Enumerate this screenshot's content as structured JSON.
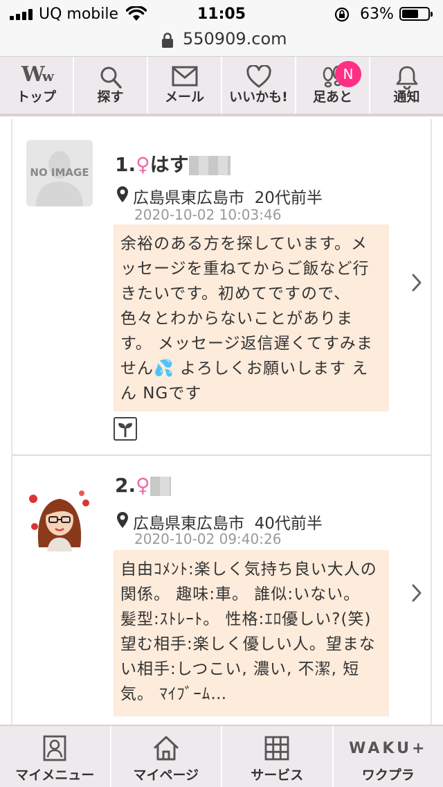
{
  "status_bar": {
    "carrier": "UQ mobile",
    "time": "11:05",
    "battery_percent": "63%",
    "battery_level": 0.63
  },
  "browser": {
    "url": "550909.com"
  },
  "top_nav": {
    "items": [
      {
        "label": "トップ",
        "icon": "ww-logo-icon"
      },
      {
        "label": "探す",
        "icon": "search-icon"
      },
      {
        "label": "メール",
        "icon": "mail-icon"
      },
      {
        "label": "いいかも!",
        "icon": "heart-icon"
      },
      {
        "label": "足あと",
        "icon": "footprints-icon",
        "badge": "N"
      },
      {
        "label": "通知",
        "icon": "bell-icon"
      }
    ]
  },
  "posts": [
    {
      "avatar_text": "NO IMAGE",
      "number": "1.",
      "gender_symbol": "♀",
      "name": "はす",
      "location": "広島県東広島市",
      "age": "20代前半",
      "timestamp": "2020-10-02 10:03:46",
      "message": "余裕のある方を探しています。メッセージを重ねてからご飯など行きたいです。初めてですので、色々とわからないことがあります。 メッセージ返信遅くてすみません💦 よろしくお願いします えん NGです"
    },
    {
      "number": "2.",
      "gender_symbol": "♀",
      "name": "",
      "location": "広島県東広島市",
      "age": "40代前半",
      "timestamp": "2020-10-02 09:40:26",
      "message": "自由ｺﾒﾝﾄ:楽しく気持ち良い大人の関係。 趣味:車。 誰似:いない。 髪型:ｽﾄﾚｰﾄ。 性格:ｴﾛ優しい?(笑) 望む相手:楽しく優しい人。望まない相手:しつこい, 濃い, 不潔, 短気。 ﾏｲﾌﾞｰﾑ…"
    }
  ],
  "bottom_nav": {
    "items": [
      {
        "label": "マイメニュー",
        "icon": "person-card-icon"
      },
      {
        "label": "マイページ",
        "icon": "home-icon"
      },
      {
        "label": "サービス",
        "icon": "grid-icon"
      },
      {
        "label": "ワクプラ",
        "icon": "waku-plus-logo",
        "logo_text": "WAKU+"
      }
    ]
  }
}
